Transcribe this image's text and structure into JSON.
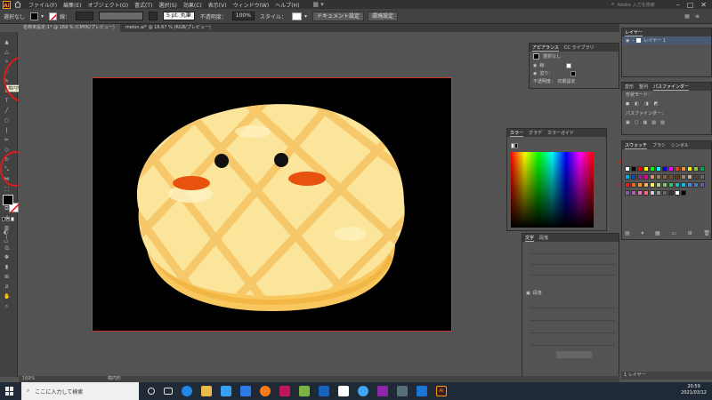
{
  "menubar": {
    "items": [
      "ファイル(F)",
      "編集(E)",
      "オブジェクト(O)",
      "書式(T)",
      "選択(S)",
      "効果(C)",
      "表示(V)",
      "ウィンドウ(W)",
      "ヘルプ(H)"
    ],
    "search_placeholder": "Adobe 入力を検索"
  },
  "controlbar": {
    "selection_label": "選択なし",
    "stroke_label": "線：",
    "brush_label": "5 pt. 丸筆",
    "opacity_label": "不透明度：",
    "opacity_value": "100%",
    "style_label": "スタイル：",
    "doc_setup_button": "ドキュメント設定",
    "prefs_button": "環境設定"
  },
  "doctabs": [
    {
      "label": "名称未設定-1* @ 169 % (CMYK/プレビュー)",
      "active": true
    },
    {
      "label": "melon.ai* @ 16.67 % (RGB/プレビュー)",
      "active": false
    }
  ],
  "toolbar": {
    "tooltip": "楕円形ツール (L)"
  },
  "panels": {
    "appearance": {
      "tabs": [
        "アピアランス",
        "CC ライブラリ"
      ],
      "title": "選択なし",
      "rows": [
        "線：",
        "塗り：",
        "不透明度：　初期設定"
      ]
    },
    "layers": {
      "tab": "レイヤー",
      "item": "レイヤー 1",
      "footer": "1 レイヤー"
    },
    "pathfinder": {
      "tabs": [
        "変形",
        "整列",
        "パスファインダー"
      ],
      "shape_modes": "形状モード：",
      "pathfinders": "パスファインダー："
    },
    "color": {
      "tabs": [
        "カラー",
        "グラデ",
        "カラーガイド"
      ]
    },
    "swatches": {
      "tabs": [
        "スウォッチ",
        "ブラシ",
        "シンボル"
      ]
    },
    "character": {
      "tabs": [
        "文字",
        "段落"
      ],
      "section": "段落"
    }
  },
  "statusbar": {
    "zoom": "169%",
    "tool": "楕円形"
  },
  "taskbar": {
    "search_placeholder": "ここに入力して検索",
    "time": "20:59",
    "date": "2021/03/12"
  },
  "colors": {
    "accent_red": "#d81b1b",
    "bread_yellow": "#fbe79a",
    "bread_crust": "#f6c45a",
    "cheek_orange": "#e8520f"
  }
}
